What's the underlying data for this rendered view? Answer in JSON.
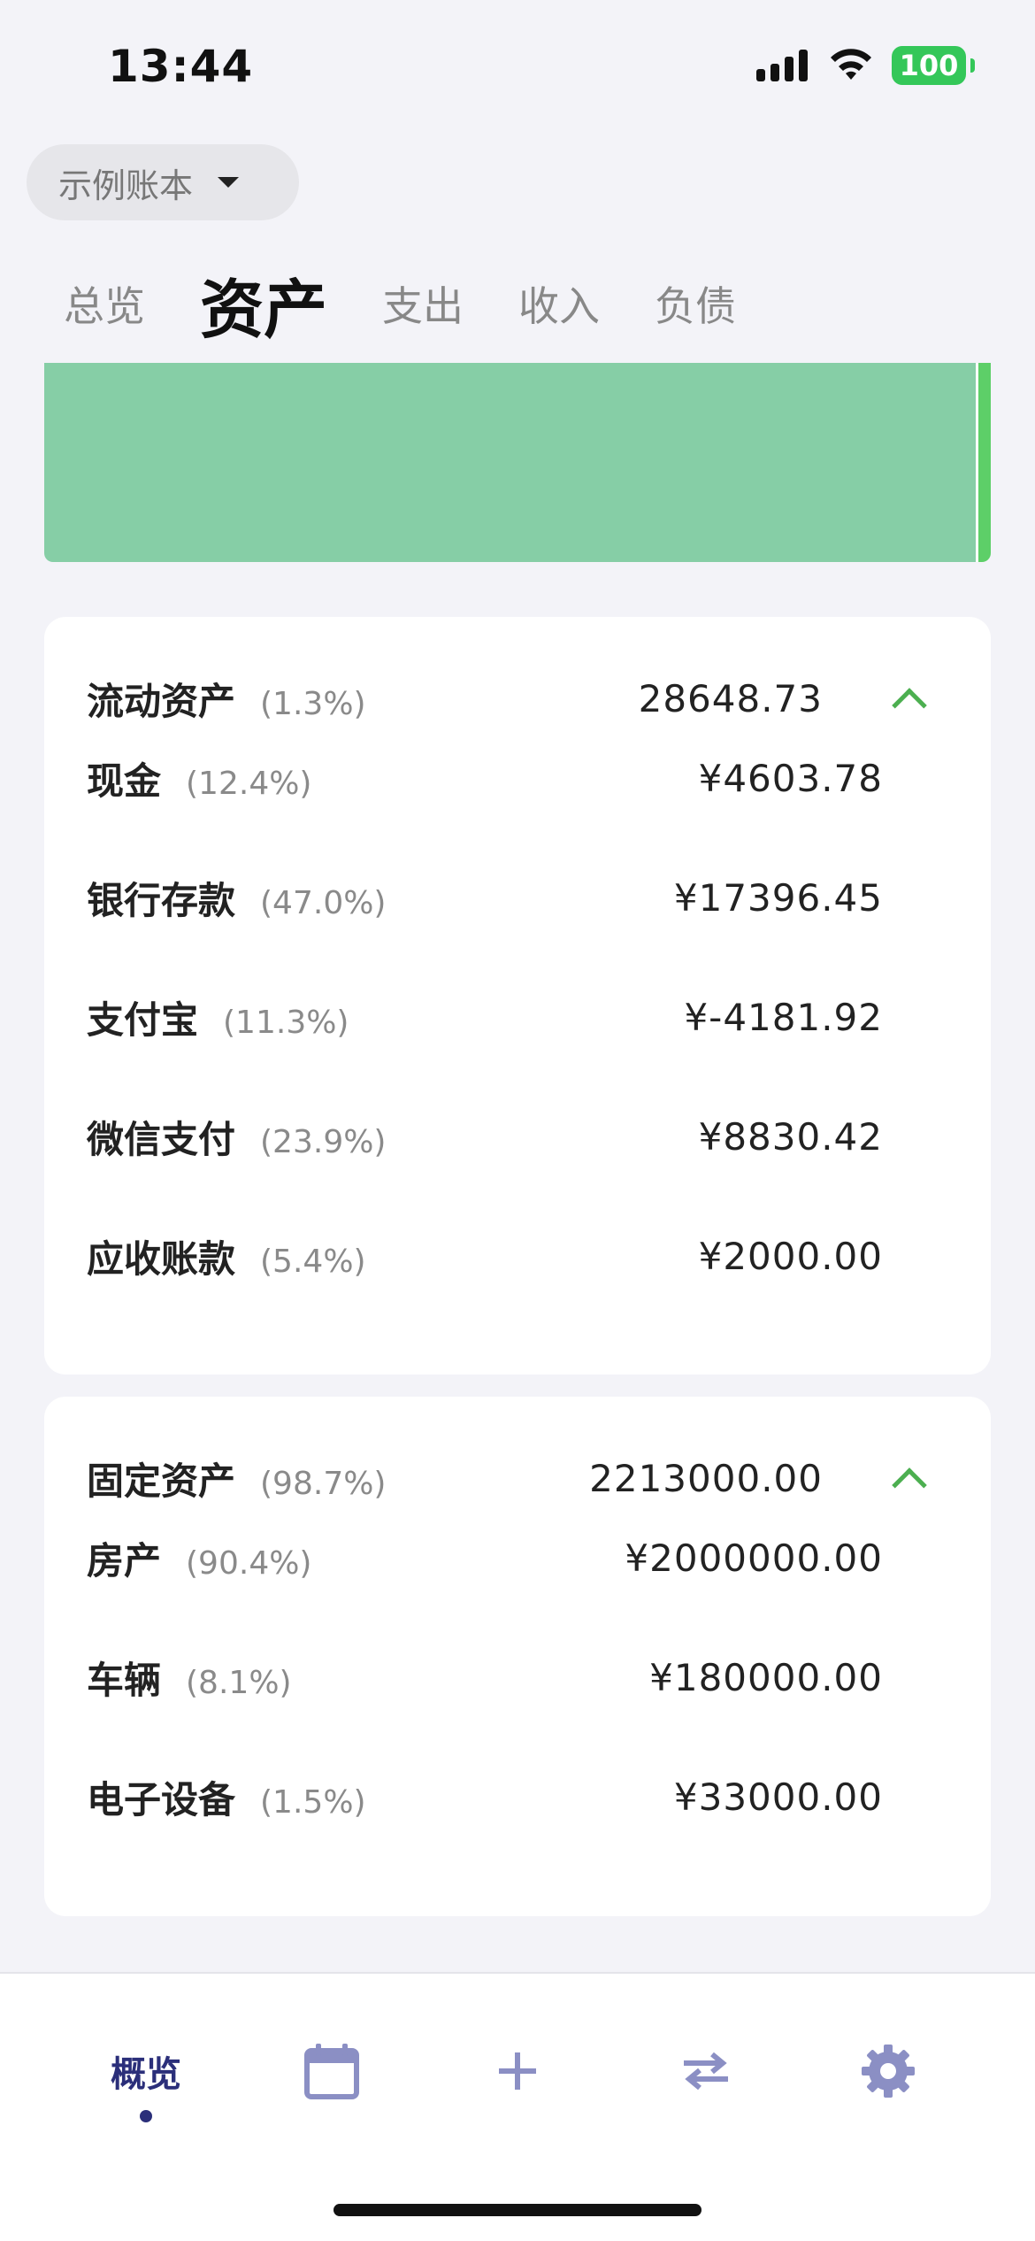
{
  "status_bar": {
    "time": "13:44",
    "battery": "100"
  },
  "ledger": {
    "label": "示例账本"
  },
  "tabs": [
    {
      "label": "总览",
      "active": false
    },
    {
      "label": "资产",
      "active": true
    },
    {
      "label": "支出",
      "active": false
    },
    {
      "label": "收入",
      "active": false
    },
    {
      "label": "负债",
      "active": false
    }
  ],
  "asset_bar": {
    "current_fraction": 0.987,
    "colors": {
      "current": "#86cea6",
      "fixed": "#5dcf68"
    }
  },
  "current_assets": {
    "title": "流动资产",
    "percent": "(1.3%)",
    "total": "28648.73",
    "items": [
      {
        "name": "现金",
        "percent": "(12.4%)",
        "amount": "¥4603.78"
      },
      {
        "name": "银行存款",
        "percent": "(47.0%)",
        "amount": "¥17396.45"
      },
      {
        "name": "支付宝",
        "percent": "(11.3%)",
        "amount": "¥-4181.92"
      },
      {
        "name": "微信支付",
        "percent": "(23.9%)",
        "amount": "¥8830.42"
      },
      {
        "name": "应收账款",
        "percent": "(5.4%)",
        "amount": "¥2000.00"
      }
    ]
  },
  "fixed_assets": {
    "title": "固定资产",
    "percent": "(98.7%)",
    "total": "2213000.00",
    "items": [
      {
        "name": "房产",
        "percent": "(90.4%)",
        "amount": "¥2000000.00"
      },
      {
        "name": "车辆",
        "percent": "(8.1%)",
        "amount": "¥180000.00"
      },
      {
        "name": "电子设备",
        "percent": "(1.5%)",
        "amount": "¥33000.00"
      }
    ]
  },
  "bottom_nav": {
    "overview_label": "概览",
    "icons": [
      "calendar-icon",
      "plus-icon",
      "swap-icon",
      "gear-icon"
    ],
    "accent": "#2b2f7a",
    "icon_color": "#8b8fc4"
  }
}
